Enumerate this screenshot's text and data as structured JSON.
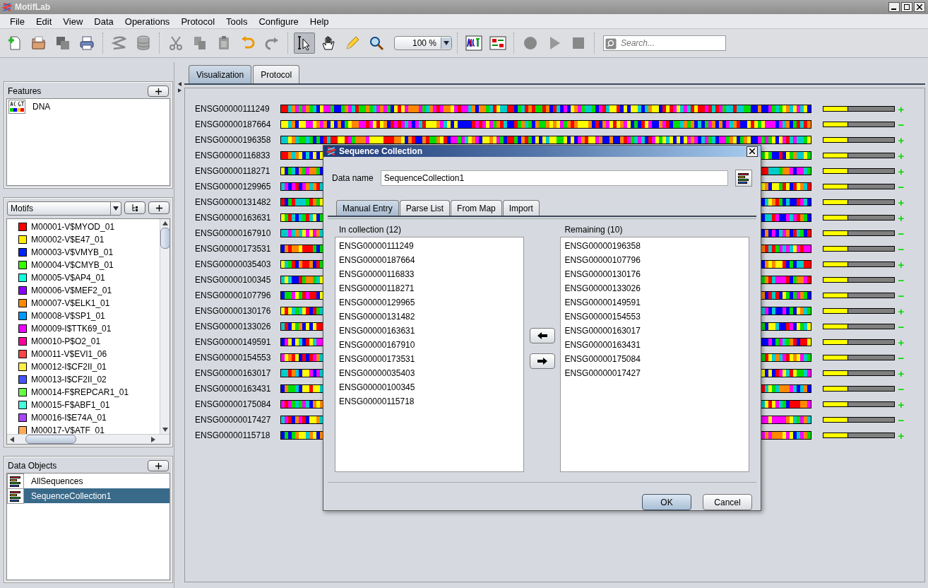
{
  "window": {
    "title": "MotifLab"
  },
  "menu": [
    "File",
    "Edit",
    "View",
    "Data",
    "Operations",
    "Protocol",
    "Tools",
    "Configure",
    "Help"
  ],
  "toolbar": {
    "tools": [
      {
        "kind": "new",
        "selected": false
      },
      {
        "kind": "open",
        "selected": false
      },
      {
        "kind": "save",
        "selected": false
      },
      {
        "kind": "print",
        "selected": false
      },
      {
        "kind": "sep"
      },
      {
        "kind": "sequence",
        "selected": false
      },
      {
        "kind": "database",
        "selected": false
      },
      {
        "kind": "sep"
      },
      {
        "kind": "cut",
        "selected": false
      },
      {
        "kind": "copy",
        "selected": false
      },
      {
        "kind": "paste",
        "selected": false
      },
      {
        "kind": "undo",
        "selected": false
      },
      {
        "kind": "redo",
        "selected": false
      },
      {
        "kind": "sep"
      },
      {
        "kind": "pointer",
        "selected": true
      },
      {
        "kind": "hand",
        "selected": false
      },
      {
        "kind": "pencil",
        "selected": false
      },
      {
        "kind": "zoom",
        "selected": false
      },
      {
        "kind": "zoomfield"
      },
      {
        "kind": "sep"
      },
      {
        "kind": "logo",
        "selected": false
      },
      {
        "kind": "compare",
        "selected": false
      },
      {
        "kind": "sep"
      },
      {
        "kind": "record",
        "selected": false
      },
      {
        "kind": "play",
        "selected": false
      },
      {
        "kind": "stop",
        "selected": false
      },
      {
        "kind": "sep"
      },
      {
        "kind": "search"
      }
    ],
    "zoom": "100 %",
    "search_placeholder": "Search..."
  },
  "features": {
    "title": "Features",
    "items": [
      {
        "name": "DNA"
      }
    ]
  },
  "motifs": {
    "selector": "Motifs",
    "items": [
      {
        "name": "M00001-V$MYOD_01",
        "color": "#ff0000"
      },
      {
        "name": "M00002-V$E47_01",
        "color": "#ffee00"
      },
      {
        "name": "M00003-V$VMYB_01",
        "color": "#0022ff"
      },
      {
        "name": "M00004-V$CMYB_01",
        "color": "#33ff00"
      },
      {
        "name": "M00005-V$AP4_01",
        "color": "#11ffdd"
      },
      {
        "name": "M00006-V$MEF2_01",
        "color": "#8800ff"
      },
      {
        "name": "M00007-V$ELK1_01",
        "color": "#ff8800"
      },
      {
        "name": "M00008-V$SP1_01",
        "color": "#0099ff"
      },
      {
        "name": "M00009-I$TTK69_01",
        "color": "#ee00ff"
      },
      {
        "name": "M00010-P$O2_01",
        "color": "#ff0099"
      },
      {
        "name": "M00011-V$EVI1_06",
        "color": "#ff4444"
      },
      {
        "name": "M00012-I$CF2II_01",
        "color": "#ffee44"
      },
      {
        "name": "M00013-I$CF2II_02",
        "color": "#4455ff"
      },
      {
        "name": "M00014-F$REPCAR1_01",
        "color": "#66ff44"
      },
      {
        "name": "M00015-F$ABF1_01",
        "color": "#44ffdd"
      },
      {
        "name": "M00016-I$E74A_01",
        "color": "#aa44ff"
      },
      {
        "name": "M00017-V$ATF_01",
        "color": "#ffaa55"
      }
    ]
  },
  "data_objects": {
    "title": "Data Objects",
    "items": [
      {
        "name": "AllSequences",
        "selected": false
      },
      {
        "name": "SequenceCollection1",
        "selected": true
      }
    ]
  },
  "tabs": [
    {
      "label": "Visualization",
      "selected": true
    },
    {
      "label": "Protocol",
      "selected": false
    }
  ],
  "sequences": [
    {
      "name": "ENSG00000111249",
      "level": 0.35,
      "strand": "+"
    },
    {
      "name": "ENSG00000187664",
      "level": 0.35,
      "strand": "−"
    },
    {
      "name": "ENSG00000196358",
      "level": 0.35,
      "strand": "+"
    },
    {
      "name": "ENSG00000116833",
      "level": 0.35,
      "strand": "+"
    },
    {
      "name": "ENSG00000118271",
      "level": 0.35,
      "strand": "+"
    },
    {
      "name": "ENSG00000129965",
      "level": 0.35,
      "strand": "−"
    },
    {
      "name": "ENSG00000131482",
      "level": 0.35,
      "strand": "+"
    },
    {
      "name": "ENSG00000163631",
      "level": 0.35,
      "strand": "+"
    },
    {
      "name": "ENSG00000167910",
      "level": 0.35,
      "strand": "−"
    },
    {
      "name": "ENSG00000173531",
      "level": 0.35,
      "strand": "−"
    },
    {
      "name": "ENSG00000035403",
      "level": 0.35,
      "strand": "+"
    },
    {
      "name": "ENSG00000100345",
      "level": 0.35,
      "strand": "−"
    },
    {
      "name": "ENSG00000107796",
      "level": 0.35,
      "strand": "−"
    },
    {
      "name": "ENSG00000130176",
      "level": 0.35,
      "strand": "+"
    },
    {
      "name": "ENSG00000133026",
      "level": 0.35,
      "strand": "−"
    },
    {
      "name": "ENSG00000149591",
      "level": 0.35,
      "strand": "+"
    },
    {
      "name": "ENSG00000154553",
      "level": 0.35,
      "strand": "−"
    },
    {
      "name": "ENSG00000163017",
      "level": 0.35,
      "strand": "+"
    },
    {
      "name": "ENSG00000163431",
      "level": 0.35,
      "strand": "−"
    },
    {
      "name": "ENSG00000175084",
      "level": 0.35,
      "strand": "+"
    },
    {
      "name": "ENSG00000017427",
      "level": 0.35,
      "strand": "−"
    },
    {
      "name": "ENSG00000115718",
      "level": 0.35,
      "strand": "+"
    }
  ],
  "dialog": {
    "title": "Sequence Collection",
    "data_name_label": "Data name",
    "data_name": "SequenceCollection1",
    "tabs": [
      {
        "label": "Manual Entry",
        "selected": true
      },
      {
        "label": "Parse List",
        "selected": false
      },
      {
        "label": "From Map",
        "selected": false
      },
      {
        "label": "Import",
        "selected": false
      }
    ],
    "in_collection": {
      "title": "In collection (12)",
      "items": [
        "ENSG00000111249",
        "ENSG00000187664",
        "ENSG00000116833",
        "ENSG00000118271",
        "ENSG00000129965",
        "ENSG00000131482",
        "ENSG00000163631",
        "ENSG00000167910",
        "ENSG00000173531",
        "ENSG00000035403",
        "ENSG00000100345",
        "ENSG00000115718"
      ]
    },
    "remaining": {
      "title": "Remaining (10)",
      "items": [
        "ENSG00000196358",
        "ENSG00000107796",
        "ENSG00000130176",
        "ENSG00000133026",
        "ENSG00000149591",
        "ENSG00000154553",
        "ENSG00000163017",
        "ENSG00000163431",
        "ENSG00000175084",
        "ENSG00000017427"
      ]
    },
    "buttons": [
      "OK",
      "Cancel"
    ]
  }
}
